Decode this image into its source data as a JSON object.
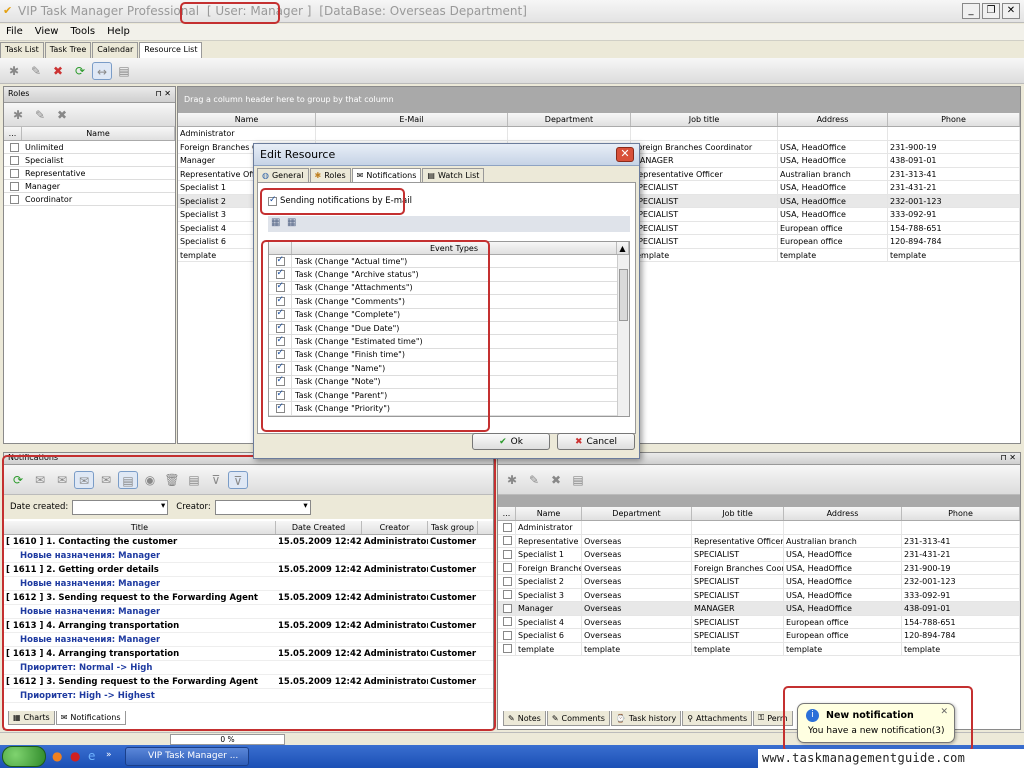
{
  "titlebar": {
    "app_name": "VIP Task Manager Professional",
    "user": "[ User: Manager ]",
    "database": "[DataBase: Overseas Department]"
  },
  "menu": [
    "File",
    "View",
    "Tools",
    "Help"
  ],
  "main_tabs": [
    "Task List",
    "Task Tree",
    "Calendar",
    "Resource List"
  ],
  "roles_panel": {
    "title": "Roles",
    "col_dots": "...",
    "col_name": "Name",
    "items": [
      "Unlimited",
      "Specialist",
      "Representative",
      "Manager",
      "Coordinator"
    ]
  },
  "resource_grid": {
    "group_hint": "Drag a column header here to group by that column",
    "columns": [
      "Name",
      "E-Mail",
      "Department",
      "Job title",
      "Address",
      "Phone"
    ],
    "rows": [
      {
        "name": "Administrator",
        "email": "",
        "dept": "",
        "job": "",
        "addr": "",
        "phone": ""
      },
      {
        "name": "Foreign Branches Coordinator",
        "email": "",
        "dept": "",
        "job": "Foreign Branches Coordinator",
        "addr": "USA, HeadOffice",
        "phone": "231-900-19"
      },
      {
        "name": "Manager",
        "email": "",
        "dept": "",
        "job": "MANAGER",
        "addr": "USA, HeadOffice",
        "phone": "438-091-01"
      },
      {
        "name": "Representative Officer",
        "email": "",
        "dept": "",
        "job": "Representative Officer",
        "addr": "Australian branch",
        "phone": "231-313-41"
      },
      {
        "name": "Specialist 1",
        "email": "",
        "dept": "",
        "job": "SPECIALIST",
        "addr": "USA, HeadOffice",
        "phone": "231-431-21"
      },
      {
        "name": "Specialist 2",
        "email": "",
        "dept": "",
        "job": "SPECIALIST",
        "addr": "USA, HeadOffice",
        "phone": "232-001-123"
      },
      {
        "name": "Specialist 3",
        "email": "",
        "dept": "",
        "job": "SPECIALIST",
        "addr": "USA, HeadOffice",
        "phone": "333-092-91"
      },
      {
        "name": "Specialist 4",
        "email": "",
        "dept": "",
        "job": "SPECIALIST",
        "addr": "European office",
        "phone": "154-788-651"
      },
      {
        "name": "Specialist 6",
        "email": "",
        "dept": "",
        "job": "SPECIALIST",
        "addr": "European office",
        "phone": "120-894-784"
      },
      {
        "name": "template",
        "email": "",
        "dept": "",
        "job": "template",
        "addr": "template",
        "phone": "template"
      }
    ]
  },
  "dialog": {
    "title": "Edit Resource",
    "tabs": [
      "General",
      "Roles",
      "Notifications",
      "Watch List"
    ],
    "checkbox_label": "Sending notifications by E-mail",
    "events_header": "Event Types",
    "events": [
      "Task (Change \"Actual time\")",
      "Task (Change \"Archive status\")",
      "Task (Change \"Attachments\")",
      "Task (Change \"Comments\")",
      "Task (Change \"Complete\")",
      "Task (Change \"Due Date\")",
      "Task (Change \"Estimated time\")",
      "Task (Change \"Finish time\")",
      "Task (Change \"Name\")",
      "Task (Change \"Note\")",
      "Task (Change \"Parent\")",
      "Task (Change \"Priority\")"
    ],
    "ok": "Ok",
    "cancel": "Cancel"
  },
  "notifications_panel": {
    "title": "Notifications",
    "date_created_label": "Date created:",
    "creator_label": "Creator:",
    "columns": [
      "Title",
      "Date Created",
      "Creator",
      "Task group"
    ],
    "rows": [
      {
        "type": "main",
        "title": "[ 1610 ] 1. Contacting the customer",
        "date": "15.05.2009 12:42:",
        "creator": "Administrator",
        "group": "Customer"
      },
      {
        "type": "sub",
        "title": "Новые назначения: Manager"
      },
      {
        "type": "main",
        "title": "[ 1611 ] 2. Getting order details",
        "date": "15.05.2009 12:42:",
        "creator": "Administrator",
        "group": "Customer"
      },
      {
        "type": "sub",
        "title": "Новые назначения: Manager"
      },
      {
        "type": "main",
        "title": "[ 1612 ] 3. Sending request to the Forwarding Agent",
        "date": "15.05.2009 12:42:",
        "creator": "Administrator",
        "group": "Customer"
      },
      {
        "type": "sub",
        "title": "Новые назначения: Manager"
      },
      {
        "type": "main",
        "title": "[ 1613 ] 4. Arranging transportation",
        "date": "15.05.2009 12:42:",
        "creator": "Administrator",
        "group": "Customer"
      },
      {
        "type": "sub",
        "title": "Новые назначения: Manager"
      },
      {
        "type": "main",
        "title": "[ 1613 ] 4. Arranging transportation",
        "date": "15.05.2009 12:42:",
        "creator": "Administrator",
        "group": "Customer"
      },
      {
        "type": "sub",
        "title": "Приоритет: Normal -> High"
      },
      {
        "type": "main",
        "title": "[ 1612 ] 3. Sending request to the Forwarding Agent",
        "date": "15.05.2009 12:42:",
        "creator": "Administrator",
        "group": "Customer"
      },
      {
        "type": "sub",
        "title": "Приоритет: High -> Highest"
      }
    ],
    "bottom_tabs": [
      "Charts",
      "Notifications"
    ]
  },
  "watch_panel": {
    "columns": [
      "...",
      "Name",
      "Department",
      "Job title",
      "Address",
      "Phone"
    ],
    "rows": [
      {
        "name": "Administrator",
        "dept": "",
        "job": "",
        "addr": "",
        "phone": ""
      },
      {
        "name": "Representative Officer",
        "dept": "Overseas",
        "job": "Representative Officer",
        "addr": "Australian branch",
        "phone": "231-313-41"
      },
      {
        "name": "Specialist 1",
        "dept": "Overseas",
        "job": "SPECIALIST",
        "addr": "USA, HeadOffice",
        "phone": "231-431-21"
      },
      {
        "name": "Foreign Branches Coordinator",
        "dept": "Overseas",
        "job": "Foreign Branches Coordinator",
        "addr": "USA, HeadOffice",
        "phone": "231-900-19"
      },
      {
        "name": "Specialist 2",
        "dept": "Overseas",
        "job": "SPECIALIST",
        "addr": "USA, HeadOffice",
        "phone": "232-001-123"
      },
      {
        "name": "Specialist 3",
        "dept": "Overseas",
        "job": "SPECIALIST",
        "addr": "USA, HeadOffice",
        "phone": "333-092-91"
      },
      {
        "name": "Manager",
        "dept": "Overseas",
        "job": "MANAGER",
        "addr": "USA, HeadOffice",
        "phone": "438-091-01"
      },
      {
        "name": "Specialist 4",
        "dept": "Overseas",
        "job": "SPECIALIST",
        "addr": "European office",
        "phone": "154-788-651"
      },
      {
        "name": "Specialist 6",
        "dept": "Overseas",
        "job": "SPECIALIST",
        "addr": "European office",
        "phone": "120-894-784"
      },
      {
        "name": "template",
        "dept": "template",
        "job": "template",
        "addr": "template",
        "phone": "template"
      }
    ],
    "bottom_tabs": [
      "Notes",
      "Comments",
      "Task history",
      "Attachments",
      "Perm"
    ]
  },
  "status": {
    "progress_text": "0 %"
  },
  "balloon": {
    "title": "New notification",
    "text": "You have a new notification(3)"
  },
  "taskbar": {
    "window_label": "VIP Task Manager ..."
  },
  "watermark_url": "www.taskmanagementguide.com"
}
